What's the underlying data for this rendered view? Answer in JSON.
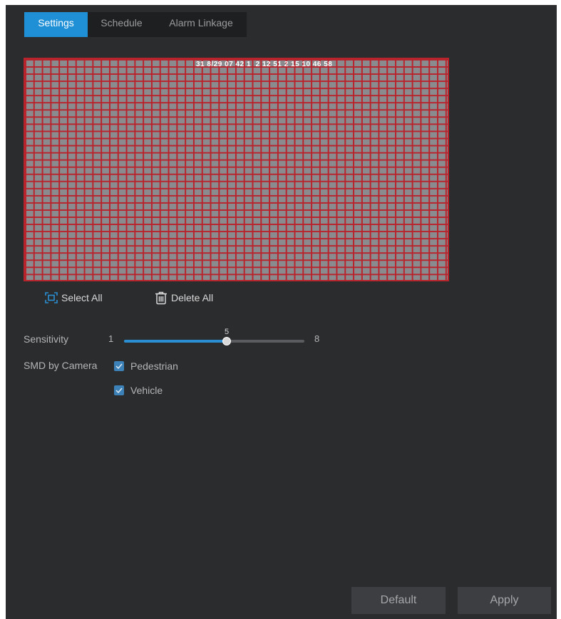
{
  "tabs": [
    {
      "label": "Settings",
      "active": true
    },
    {
      "label": "Schedule",
      "active": false
    },
    {
      "label": "Alarm Linkage",
      "active": false
    }
  ],
  "video": {
    "osd_text": "31 8/29 07 42 1  2 12 51 2 15 10 46 58"
  },
  "actions": {
    "select_all": "Select All",
    "delete_all": "Delete All"
  },
  "sensitivity": {
    "label": "Sensitivity",
    "min": "1",
    "max": "8",
    "value": "5",
    "fraction": 0.571
  },
  "smd": {
    "label": "SMD by Camera",
    "options": [
      {
        "label": "Pedestrian",
        "checked": true
      },
      {
        "label": "Vehicle",
        "checked": true
      }
    ]
  },
  "buttons": {
    "default": "Default",
    "apply": "Apply"
  },
  "colors": {
    "accent": "#1f8fd6",
    "grid": "#b8232c",
    "panel": "#2b2c2e"
  }
}
